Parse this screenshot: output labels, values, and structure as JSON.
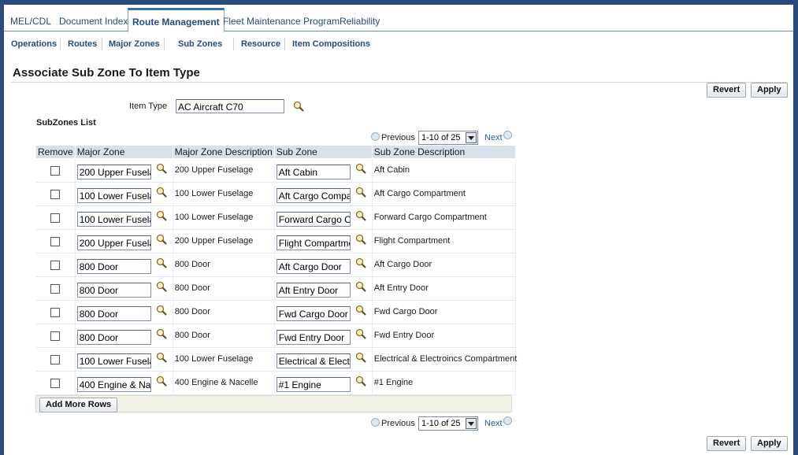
{
  "tabs": [
    {
      "label": "MEL/CDL"
    },
    {
      "label": "Document Index"
    },
    {
      "label": "Route Management",
      "active": true
    },
    {
      "label": "Fleet Maintenance Program"
    },
    {
      "label": "Reliability"
    }
  ],
  "subtabs": [
    {
      "label": "Operations"
    },
    {
      "label": "Routes"
    },
    {
      "label": "Major Zones"
    },
    {
      "label": "Sub Zones",
      "active": true
    },
    {
      "label": "Resource"
    },
    {
      "label": "Item Compositions"
    }
  ],
  "page": {
    "title": "Associate Sub Zone To Item Type",
    "revert_label": "Revert",
    "apply_label": "Apply"
  },
  "item_type": {
    "label": "Item Type",
    "value": "AC Aircraft C70"
  },
  "list_title": "SubZones List",
  "pager": {
    "previous": "Previous",
    "range": "1-10 of 25",
    "next": "Next"
  },
  "table": {
    "headers": [
      "Remove",
      "Major Zone",
      "Major Zone Description",
      "Sub Zone",
      "Sub Zone Description"
    ],
    "rows": [
      {
        "major_zone": "200 Upper Fusela",
        "major_desc": "200 Upper Fuselage",
        "sub_zone": "Aft Cabin",
        "sub_desc": "Aft Cabin"
      },
      {
        "major_zone": "100 Lower Fusela",
        "major_desc": "100 Lower Fuselage",
        "sub_zone": "Aft Cargo Compa",
        "sub_desc": "Aft Cargo Compartment"
      },
      {
        "major_zone": "100 Lower Fusela",
        "major_desc": "100 Lower Fuselage",
        "sub_zone": "Forward Cargo C",
        "sub_desc": "Forward Cargo Compartment"
      },
      {
        "major_zone": "200 Upper Fusela",
        "major_desc": "200 Upper Fuselage",
        "sub_zone": "Flight Compartme",
        "sub_desc": "Flight Compartment"
      },
      {
        "major_zone": "800 Door",
        "major_desc": "800 Door",
        "sub_zone": "Aft Cargo Door",
        "sub_desc": "Aft Cargo Door"
      },
      {
        "major_zone": "800 Door",
        "major_desc": "800 Door",
        "sub_zone": "Aft Entry Door",
        "sub_desc": "Aft Entry Door"
      },
      {
        "major_zone": "800 Door",
        "major_desc": "800 Door",
        "sub_zone": "Fwd Cargo Door",
        "sub_desc": "Fwd Cargo Door"
      },
      {
        "major_zone": "800 Door",
        "major_desc": "800 Door",
        "sub_zone": "Fwd Entry Door",
        "sub_desc": "Fwd Entry Door"
      },
      {
        "major_zone": "100 Lower Fusela",
        "major_desc": "100 Lower Fuselage",
        "sub_zone": "Electrical & Elect",
        "sub_desc": "Electrical & Electroincs Compartment"
      },
      {
        "major_zone": "400 Engine & Na",
        "major_desc": "400 Engine & Nacelle",
        "sub_zone": "#1 Engine",
        "sub_desc": "#1 Engine"
      }
    ]
  },
  "add_more_rows_label": "Add More Rows",
  "icons": {
    "search": "magnifier-icon",
    "previous": "previous-arrow-icon",
    "next": "next-arrow-icon",
    "dropdown": "dropdown-arrow-icon"
  },
  "colors": {
    "frame": "#294a7b",
    "link": "#224d7d",
    "header_bg": "#d7e0eb"
  }
}
